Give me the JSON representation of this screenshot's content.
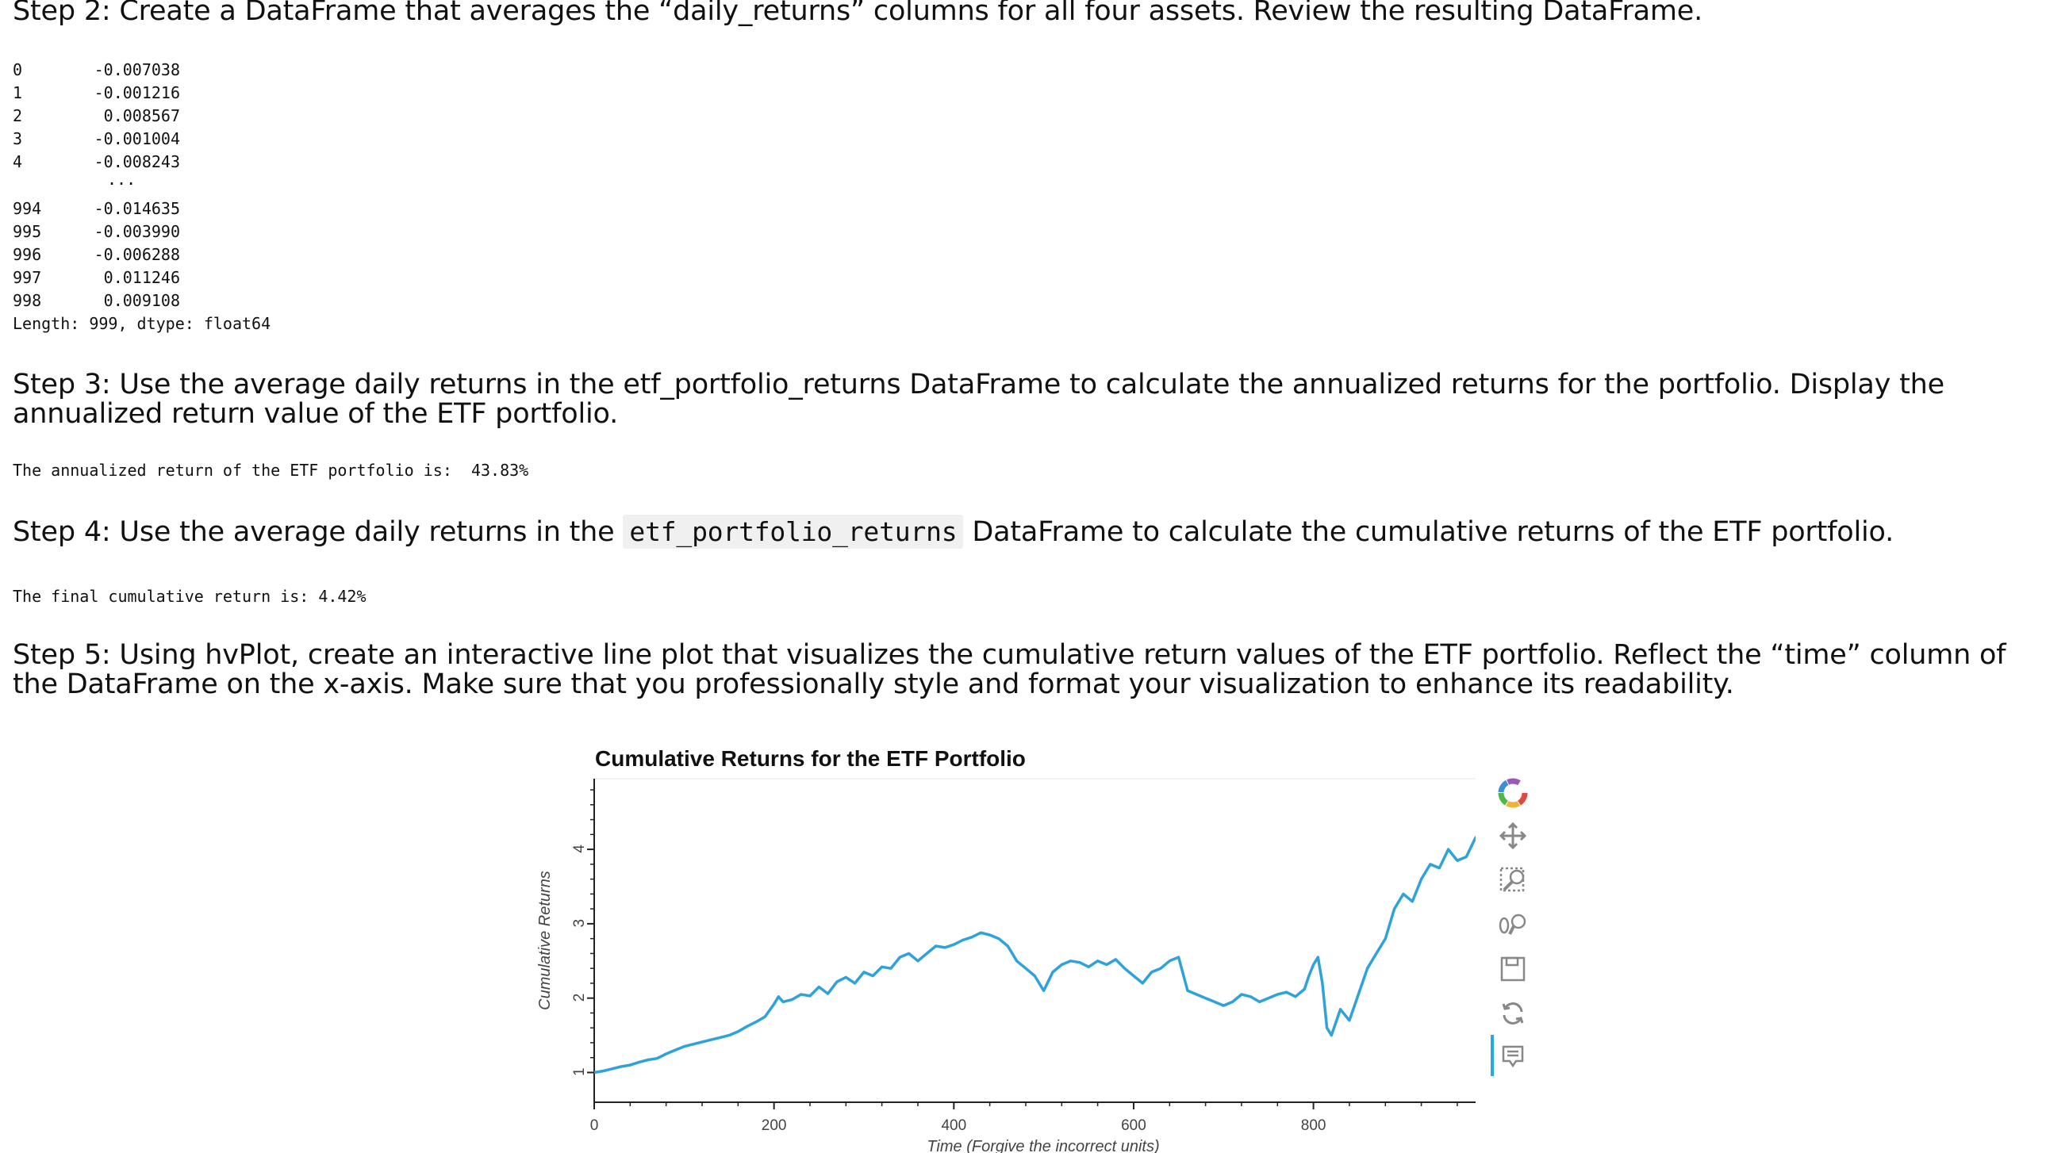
{
  "step2": {
    "heading": "Step 2: Create a DataFrame that averages the “daily_returns” columns for all four assets. Review the resulting DataFrame.",
    "rows_head": [
      {
        "index": "0",
        "value": "-0.007038"
      },
      {
        "index": "1",
        "value": "-0.001216"
      },
      {
        "index": "2",
        "value": "0.008567"
      },
      {
        "index": "3",
        "value": "-0.001004"
      },
      {
        "index": "4",
        "value": "-0.008243"
      }
    ],
    "ellipsis": "...",
    "rows_tail": [
      {
        "index": "994",
        "value": "-0.014635"
      },
      {
        "index": "995",
        "value": "-0.003990"
      },
      {
        "index": "996",
        "value": "-0.006288"
      },
      {
        "index": "997",
        "value": "0.011246"
      },
      {
        "index": "998",
        "value": "0.009108"
      }
    ],
    "footer": "Length: 999, dtype: float64"
  },
  "step3": {
    "heading": "Step 3: Use the average daily returns in the etf_portfolio_returns DataFrame to calculate the annualized returns for the portfolio. Display the annualized return value of the ETF portfolio.",
    "output": "The annualized return of the ETF portfolio is:  43.83%"
  },
  "step4": {
    "heading_before": "Step 4: Use the average daily returns in the",
    "heading_code": "etf_portfolio_returns",
    "heading_after": "DataFrame to calculate the cumulative returns of the ETF portfolio.",
    "output": "The final cumulative return is: 4.42%"
  },
  "step5": {
    "heading": "Step 5: Using hvPlot, create an interactive line plot that visualizes the cumulative return values of the ETF portfolio. Reflect the “time” column of the DataFrame on the x-axis. Make sure that you professionally style and format your visualization to enhance its readability."
  },
  "chart_data": {
    "type": "line",
    "title": "Cumulative Returns for the ETF Portfolio",
    "xlabel": "Time (Forgive the incorrect units)",
    "ylabel": "Cumulative Returns",
    "xlim": [
      0,
      998
    ],
    "ylim": [
      0.6,
      4.95
    ],
    "x_ticks": [
      0,
      200,
      400,
      600,
      800
    ],
    "y_ticks": [
      1,
      2,
      3,
      4
    ],
    "grid": false,
    "line_color": "#30a2da",
    "series": [
      {
        "x": [
          0,
          10,
          20,
          30,
          40,
          50,
          60,
          70,
          80,
          90,
          100,
          110,
          120,
          130,
          140,
          150,
          160,
          170,
          180,
          190,
          200,
          205,
          210,
          220,
          230,
          240,
          250,
          260,
          270,
          280,
          290,
          300,
          310,
          320,
          330,
          340,
          350,
          360,
          370,
          380,
          390,
          400,
          410,
          420,
          430,
          440,
          450,
          460,
          465,
          470,
          480,
          490,
          500,
          510,
          520,
          530,
          540,
          550,
          560,
          570,
          580,
          590,
          600,
          610,
          620,
          630,
          640,
          650,
          660,
          670,
          680,
          690,
          700,
          710,
          720,
          730,
          740,
          750,
          760,
          770,
          780,
          790,
          795,
          800,
          805,
          810,
          815,
          820,
          830,
          840,
          850,
          860,
          870,
          880,
          890,
          900,
          910,
          920,
          930,
          940,
          950,
          960,
          970,
          980,
          990,
          998
        ],
        "y": [
          1.0,
          1.02,
          1.05,
          1.08,
          1.1,
          1.14,
          1.17,
          1.19,
          1.25,
          1.3,
          1.35,
          1.38,
          1.41,
          1.44,
          1.47,
          1.5,
          1.55,
          1.62,
          1.68,
          1.75,
          1.92,
          2.02,
          1.95,
          1.98,
          2.05,
          2.03,
          2.15,
          2.06,
          2.22,
          2.28,
          2.2,
          2.35,
          2.3,
          2.42,
          2.4,
          2.55,
          2.6,
          2.5,
          2.6,
          2.7,
          2.68,
          2.72,
          2.78,
          2.82,
          2.88,
          2.85,
          2.8,
          2.7,
          2.6,
          2.5,
          2.4,
          2.3,
          2.1,
          2.35,
          2.45,
          2.5,
          2.48,
          2.42,
          2.5,
          2.45,
          2.52,
          2.4,
          2.3,
          2.2,
          2.35,
          2.4,
          2.5,
          2.55,
          2.1,
          2.05,
          2.0,
          1.95,
          1.9,
          1.95,
          2.05,
          2.02,
          1.95,
          2.0,
          2.05,
          2.08,
          2.02,
          2.12,
          2.3,
          2.45,
          2.55,
          2.2,
          1.6,
          1.5,
          1.85,
          1.7,
          2.05,
          2.4,
          2.6,
          2.8,
          3.2,
          3.4,
          3.3,
          3.6,
          3.8,
          3.75,
          4.0,
          3.85,
          3.9,
          4.15,
          4.3,
          4.42
        ]
      }
    ]
  }
}
